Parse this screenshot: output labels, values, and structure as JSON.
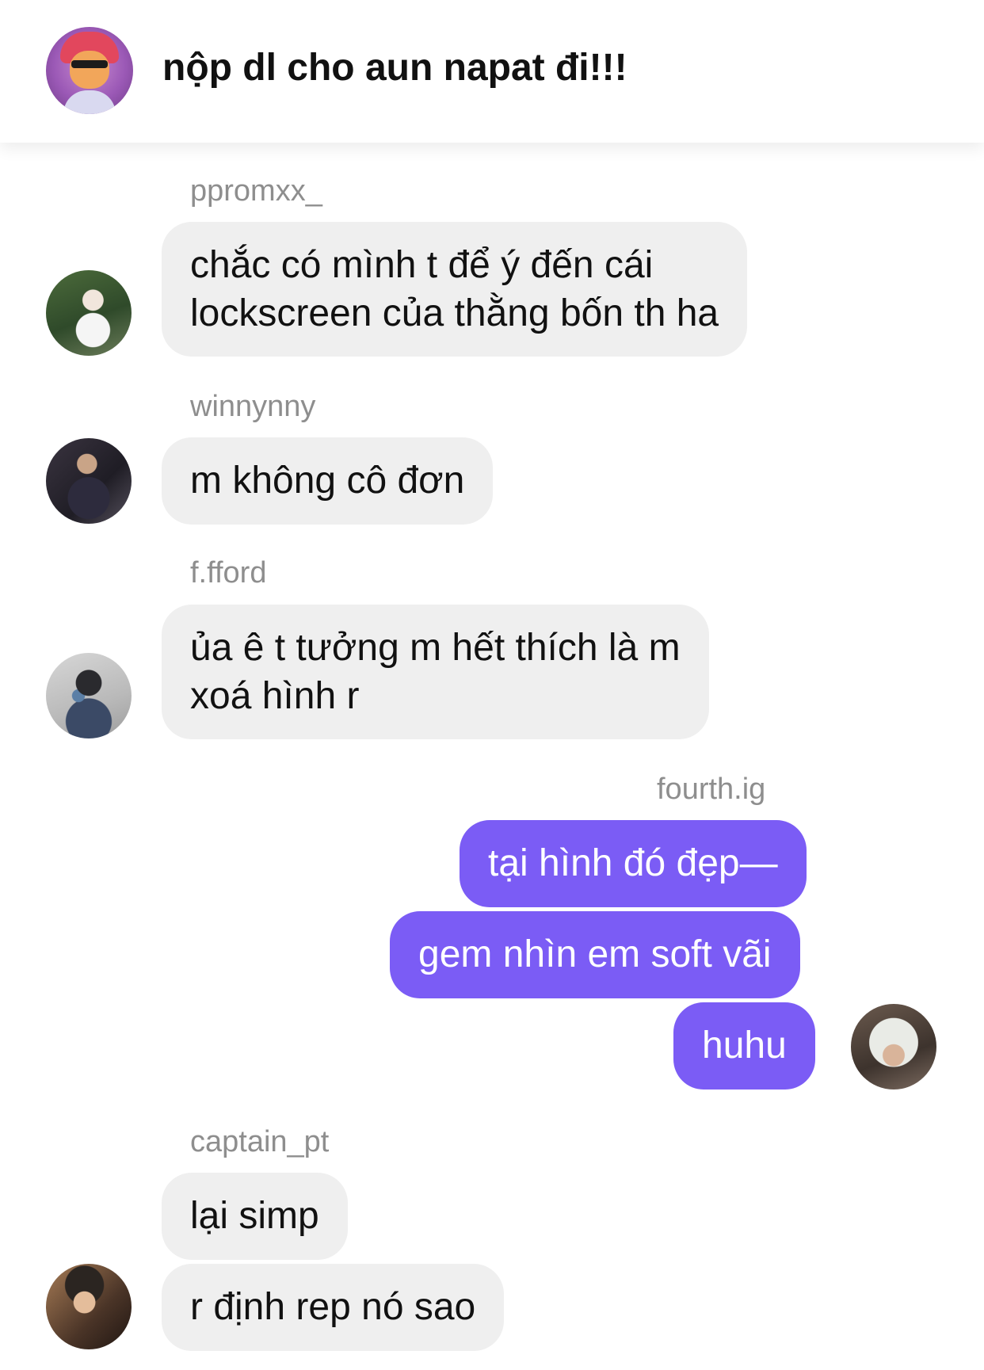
{
  "header": {
    "title": "nộp dl cho aun napat đi!!!"
  },
  "messages": [
    {
      "username": "ppromxx_",
      "lines": [
        "chắc có mình t để ý đến cái",
        "lockscreen của thằng bốn th ha"
      ]
    },
    {
      "username": "winnynny",
      "lines": [
        "m không cô đơn"
      ]
    },
    {
      "username": "f.fford",
      "lines": [
        "ủa ê t tưởng m hết thích là m",
        "xoá hình r"
      ]
    },
    {
      "username": "fourth.ig",
      "bubbles": [
        "tại hình đó đẹp—",
        "gem nhìn em soft vãi",
        "huhu"
      ]
    },
    {
      "username": "captain_pt",
      "bubbles": [
        "lại simp",
        "r định rep nó sao"
      ]
    }
  ],
  "colors": {
    "outgoing_bubble": "#7b5cf5",
    "incoming_bubble": "#efefef",
    "username_text": "#8e8e8e"
  }
}
